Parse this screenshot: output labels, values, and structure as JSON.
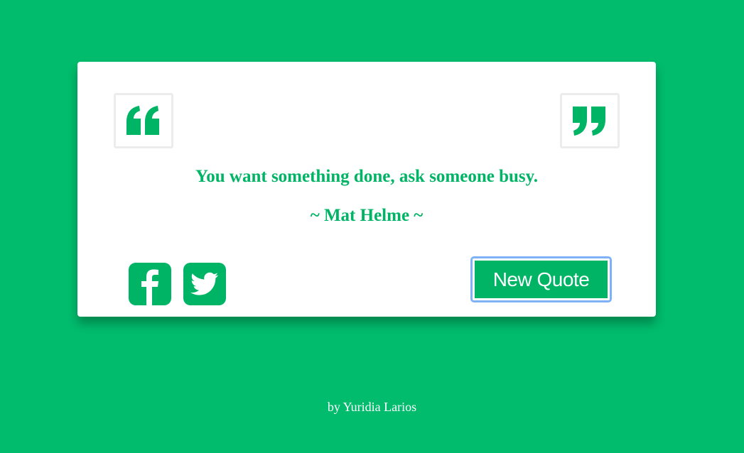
{
  "colors": {
    "background": "#00bc6c",
    "accent": "#00b466",
    "card": "#ffffff",
    "focus_ring": "#7fb1f7"
  },
  "quote": {
    "open_icon": "open-quote-icon",
    "close_icon": "close-quote-icon",
    "text": "You want something done, ask someone busy.",
    "author": "~ Mat Helme ~"
  },
  "social": {
    "facebook_icon": "facebook-icon",
    "twitter_icon": "twitter-icon"
  },
  "actions": {
    "new_quote_label": "New Quote"
  },
  "footer": {
    "credit": "by Yuridia Larios"
  }
}
